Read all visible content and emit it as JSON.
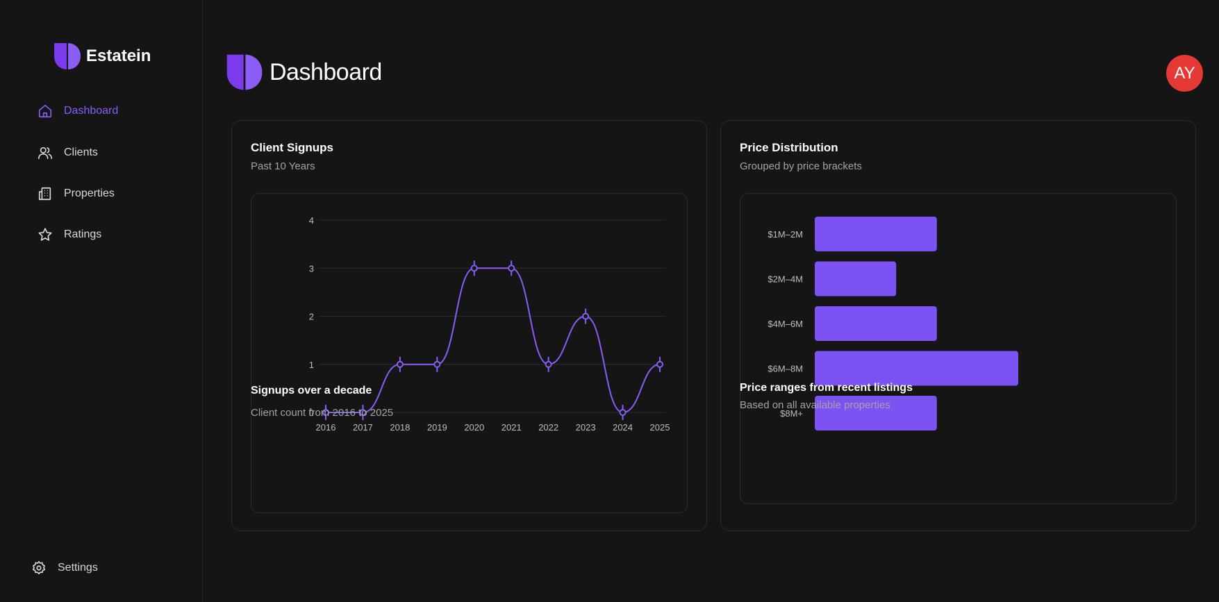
{
  "sidebar": {
    "brand": "Estatein",
    "items": [
      {
        "label": "Dashboard",
        "icon": "home-icon",
        "active": true
      },
      {
        "label": "Clients",
        "icon": "users-icon",
        "active": false
      },
      {
        "label": "Properties",
        "icon": "building-icon",
        "active": false
      },
      {
        "label": "Ratings",
        "icon": "star-icon",
        "active": false
      }
    ],
    "settings": {
      "label": "Settings",
      "icon": "gear-icon"
    }
  },
  "header": {
    "title": "Dashboard",
    "avatar_initials": "AY"
  },
  "colors": {
    "accent": "#8b5cf6",
    "bar": "#7c53f2",
    "avatar": "#e53935"
  },
  "cards": {
    "signups": {
      "title": "Client Signups",
      "subtitle": "Past 10 Years",
      "footer_title": "Signups over a decade",
      "footer_subtitle": "Client count from 2016 to 2025"
    },
    "prices": {
      "title": "Price Distribution",
      "subtitle": "Grouped by price brackets",
      "footer_title": "Price ranges from recent listings",
      "footer_subtitle": "Based on all available properties"
    }
  },
  "chart_data": [
    {
      "type": "line",
      "x": [
        "2016",
        "2017",
        "2018",
        "2019",
        "2020",
        "2021",
        "2022",
        "2023",
        "2024",
        "2025"
      ],
      "series": [
        {
          "values": [
            0,
            0,
            1,
            1,
            3,
            3,
            1,
            2,
            0,
            1
          ]
        }
      ],
      "y_ticks": [
        0,
        1,
        2,
        3,
        4
      ],
      "ylim": [
        0,
        4
      ],
      "grid": true,
      "curve": "smooth"
    },
    {
      "type": "bar",
      "orientation": "horizontal",
      "categories": [
        "$1M–2M",
        "$2M–4M",
        "$4M–6M",
        "$6M–8M",
        "$8M+"
      ],
      "series": [
        {
          "values": [
            3,
            2,
            3,
            5,
            3
          ]
        }
      ],
      "xlim": [
        0,
        5
      ],
      "grid": false
    }
  ]
}
